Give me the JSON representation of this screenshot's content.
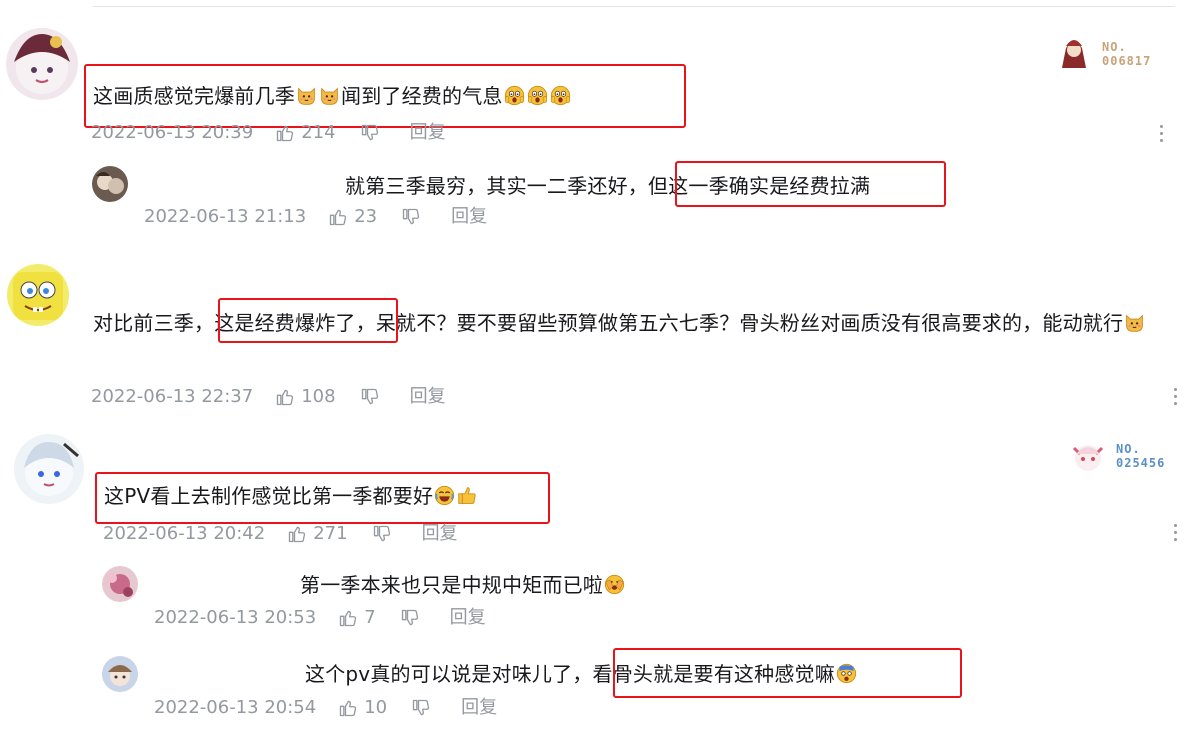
{
  "colors": {
    "highlight": "#e8141a",
    "meta": "#9499a0",
    "text": "#18191c"
  },
  "comments": [
    {
      "text_before": "这画质感觉完爆前几季",
      "emoji_1": "cat-emoji",
      "text_after": "闻到了经费的气息",
      "emoji_2": "scared-face-emoji",
      "date": "2022-06-13 20:39",
      "likes": "214",
      "reply_label": "回复",
      "fan_badge": {
        "line1": "NO.",
        "line2": "006817",
        "color": "#c8a37a"
      }
    },
    {
      "text_plain": "就第三季最穷，其实一二季还好，",
      "text_highlight": "但这一季确实是经费拉满",
      "date": "2022-06-13 21:13",
      "likes": "23",
      "reply_label": "回复"
    },
    {
      "text_pre": "对比前三季，",
      "text_highlight": "这是经费爆炸了，",
      "text_post": "呆就不？要不要留些预算做第五六七季？骨头粉丝对画质没有很高要求的，能动就行",
      "emoji": "cat-emoji",
      "date": "2022-06-13 22:37",
      "likes": "108",
      "reply_label": "回复"
    },
    {
      "text": "这PV看上去制作感觉比第一季都要好",
      "emoji_1": "laugh-cry-emoji",
      "emoji_2": "thumbs-up-emoji",
      "date": "2022-06-13 20:42",
      "likes": "271",
      "reply_label": "回复",
      "fan_badge": {
        "line1": "NO.",
        "line2": "025456",
        "color": "#5b8fc9"
      }
    },
    {
      "text": "第一季本来也只是中规中矩而已啦",
      "emoji": "cover-face-emoji",
      "date": "2022-06-13 20:53",
      "likes": "7",
      "reply_label": "回复"
    },
    {
      "text_plain": "这个pv真的可以说是对味儿了，",
      "text_highlight": "看骨头就是要有这种感觉嘛",
      "emoji": "shocked-emoji",
      "date": "2022-06-13 20:54",
      "likes": "10",
      "reply_label": "回复"
    }
  ]
}
